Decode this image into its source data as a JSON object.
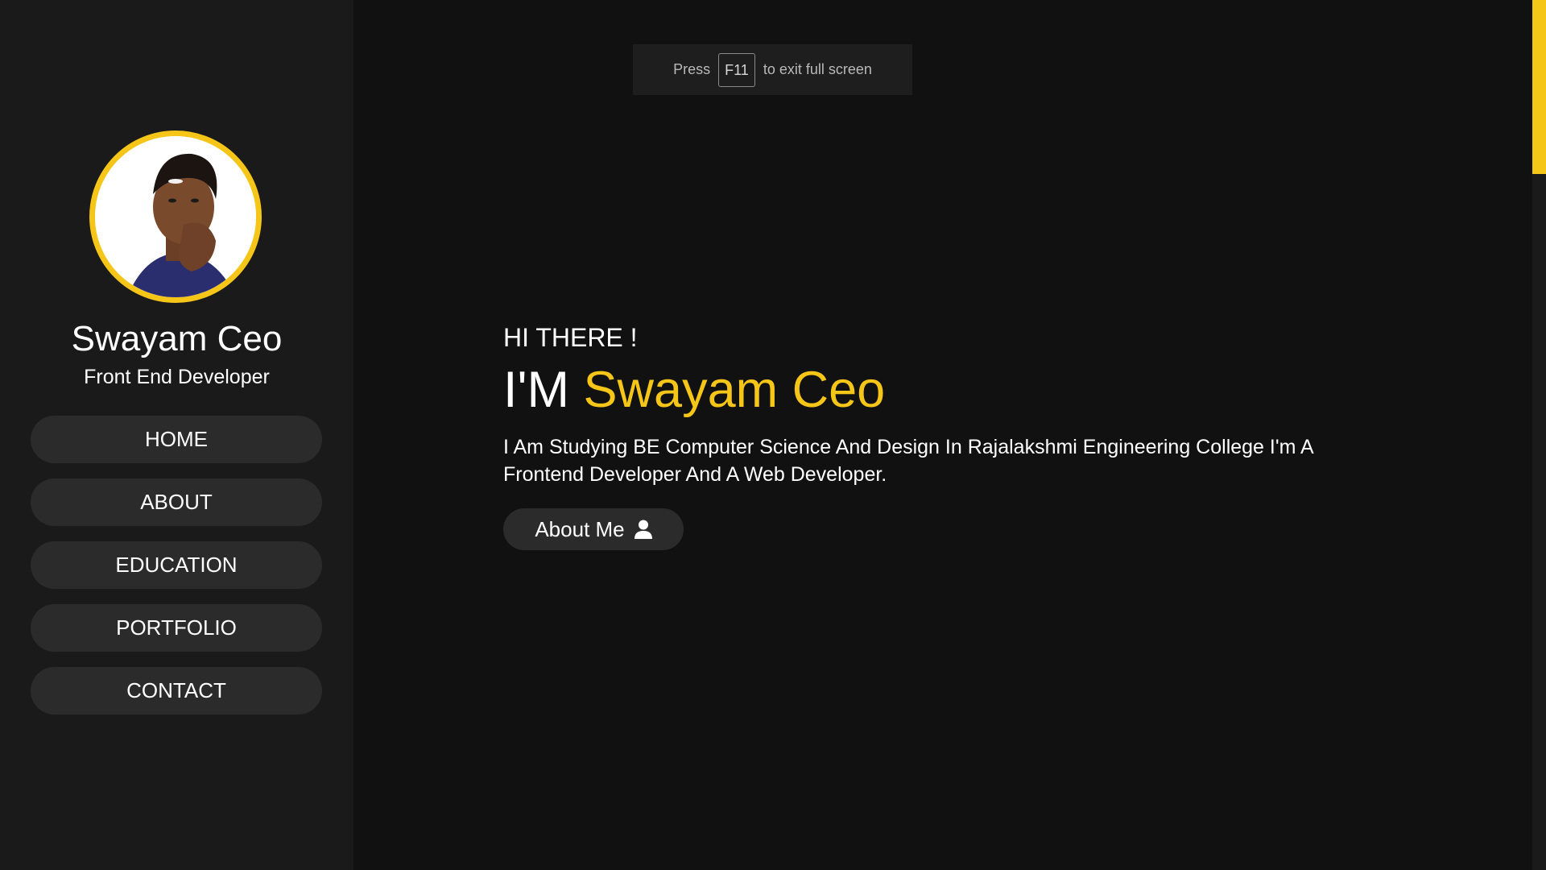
{
  "theme": {
    "accent": "#f5c518",
    "background": "#111111",
    "sidebar_background": "#1a1a1a",
    "button_background": "#2b2b2b"
  },
  "fullscreen_notice": {
    "before": "Press",
    "key": "F11",
    "after": "to exit full screen"
  },
  "sidebar": {
    "avatar_icon": "profile-photo",
    "name": "Swayam Ceo",
    "role": "Front End Developer",
    "nav": [
      {
        "label": "HOME"
      },
      {
        "label": "ABOUT"
      },
      {
        "label": "EDUCATION"
      },
      {
        "label": "PORTFOLIO"
      },
      {
        "label": "CONTACT"
      }
    ]
  },
  "hero": {
    "greeting": "HI THERE !",
    "headline_prefix": "I'M",
    "headline_name": "Swayam Ceo",
    "bio": "I Am Studying BE Computer Science And Design In Rajalakshmi Engineering College I'm A Frontend Developer And A Web Developer.",
    "button_label": "About Me",
    "button_icon": "user-icon"
  }
}
